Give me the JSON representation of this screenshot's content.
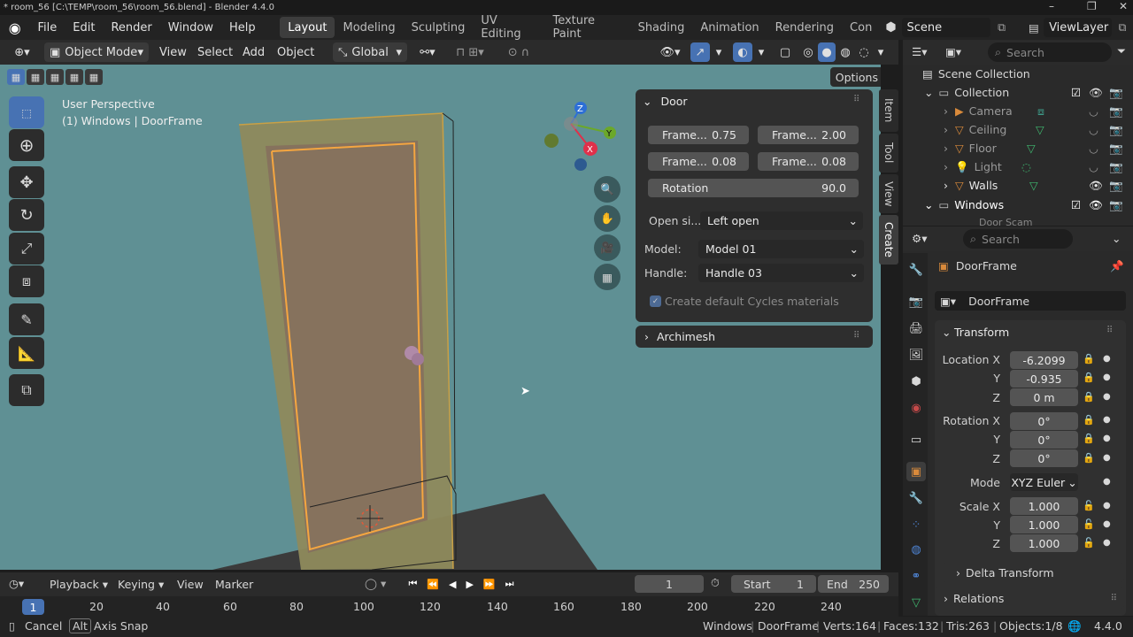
{
  "window": {
    "title": "* room_56 [C:\\TEMP\\room_56\\room_56.blend] - Blender 4.4.0"
  },
  "menus": [
    "File",
    "Edit",
    "Render",
    "Window",
    "Help"
  ],
  "workspaces": [
    "Layout",
    "Modeling",
    "Sculpting",
    "UV Editing",
    "Texture Paint",
    "Shading",
    "Animation",
    "Rendering",
    "Con"
  ],
  "scene": {
    "name": "Scene",
    "view_layer": "ViewLayer"
  },
  "viewport_header": {
    "mode": "Object Mode",
    "menus": [
      "View",
      "Select",
      "Add",
      "Object"
    ],
    "orientation": "Global",
    "options": "Options"
  },
  "viewport": {
    "perspective": "User Perspective",
    "context": "(1) Windows | DoorFrame",
    "axes": {
      "x": "X",
      "y": "Y",
      "z": "Z"
    }
  },
  "npanel": {
    "header": "Door",
    "fields": [
      {
        "label": "Frame...",
        "value": "0.75"
      },
      {
        "label": "Frame...",
        "value": "2.00"
      },
      {
        "label": "Frame...",
        "value": "0.08"
      },
      {
        "label": "Frame...",
        "value": "0.08"
      }
    ],
    "rotation": {
      "label": "Rotation",
      "value": "90.0"
    },
    "open_side": {
      "label": "Open si...",
      "value": "Left open"
    },
    "model": {
      "label": "Model:",
      "value": "Model 01"
    },
    "handle": {
      "label": "Handle:",
      "value": "Handle 03"
    },
    "checkbox": "Create default Cycles materials",
    "archimesh": "Archimesh",
    "tabs": [
      "Item",
      "Tool",
      "View",
      "Create"
    ]
  },
  "outliner": {
    "search_placeholder": "Search",
    "root": "Scene Collection",
    "collection": "Collection",
    "items": [
      "Camera",
      "Ceiling",
      "Floor",
      "Light",
      "Walls"
    ],
    "windows": "Windows",
    "partial": "Door Scam"
  },
  "properties": {
    "search_placeholder": "Search",
    "object_name": "DoorFrame",
    "data_name": "DoorFrame",
    "transform": "Transform",
    "location": {
      "label": "Location X",
      "x": "-6.2099",
      "y": "-0.935",
      "z": "0 m"
    },
    "rotation": {
      "label": "Rotation X",
      "x": "0°",
      "y": "0°",
      "z": "0°"
    },
    "mode": {
      "label": "Mode",
      "value": "XYZ Euler"
    },
    "scale": {
      "label": "Scale X",
      "x": "1.000",
      "y": "1.000",
      "z": "1.000"
    },
    "axis_y": "Y",
    "axis_z": "Z",
    "delta": "Delta Transform",
    "relations": "Relations"
  },
  "timeline": {
    "menus": [
      "Playback",
      "Keying",
      "View",
      "Marker"
    ],
    "current_frame": "1",
    "start_label": "Start",
    "start": "1",
    "end_label": "End",
    "end": "250",
    "ticks": [
      "1",
      "20",
      "40",
      "60",
      "80",
      "100",
      "120",
      "140",
      "160",
      "180",
      "200",
      "220",
      "240"
    ]
  },
  "status": {
    "cancel": "Cancel",
    "alt": "Alt",
    "axis_snap": "Axis Snap",
    "collection": "Windows",
    "object": "DoorFrame",
    "verts": "Verts:164",
    "faces": "Faces:132",
    "tris": "Tris:263",
    "objects": "Objects:1/8",
    "version": "4.4.0"
  }
}
